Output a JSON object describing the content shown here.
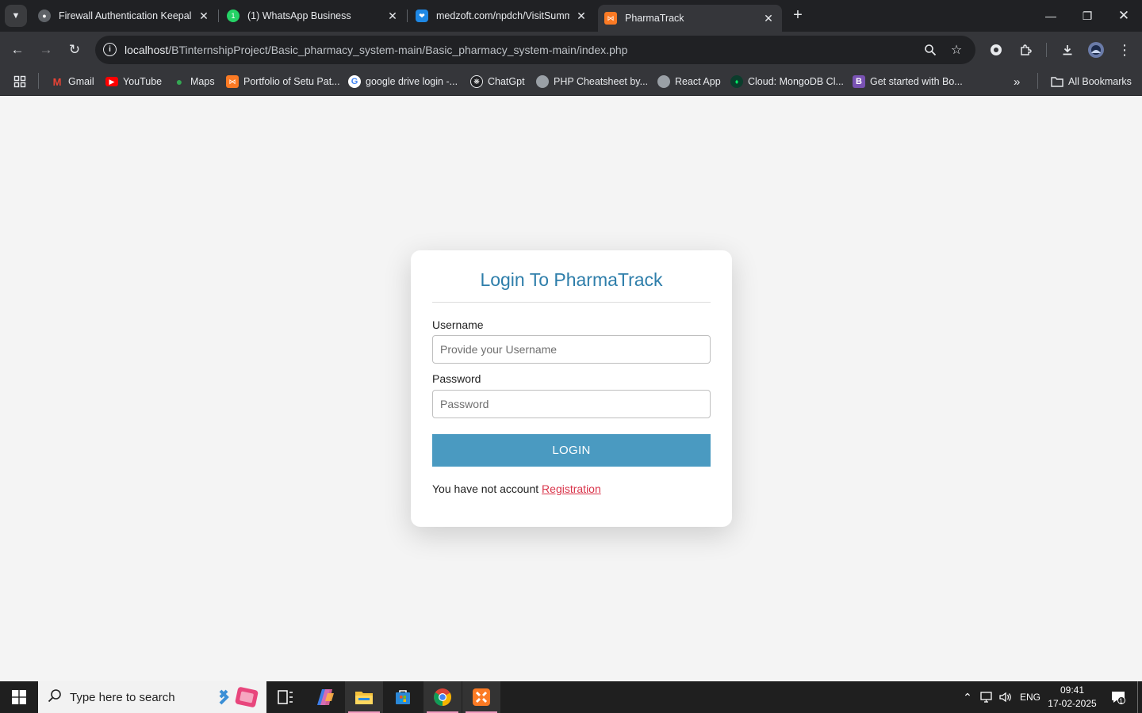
{
  "browser": {
    "tabs": [
      {
        "title": "Firewall Authentication Keepalive",
        "favicon": "globe-icon",
        "active": false
      },
      {
        "title": "(1) WhatsApp Business",
        "favicon": "whatsapp-icon",
        "active": false
      },
      {
        "title": "medzoft.com/npdch/VisitSummary",
        "favicon": "medzoft-icon",
        "active": false
      },
      {
        "title": "PharmaTrack",
        "favicon": "xampp-icon",
        "active": true
      }
    ],
    "address": {
      "host": "localhost",
      "path": "/BTinternshipProject/Basic_pharmacy_system-main/Basic_pharmacy_system-main/index.php"
    },
    "bookmarks": [
      {
        "label": "Gmail",
        "icon": "gmail-icon"
      },
      {
        "label": "YouTube",
        "icon": "youtube-icon"
      },
      {
        "label": "Maps",
        "icon": "maps-icon"
      },
      {
        "label": "Portfolio of Setu Pat...",
        "icon": "xampp-icon"
      },
      {
        "label": "google drive login -...",
        "icon": "google-icon"
      },
      {
        "label": "ChatGpt",
        "icon": "chatgpt-icon"
      },
      {
        "label": "PHP Cheatsheet by...",
        "icon": "globe-icon"
      },
      {
        "label": "React App",
        "icon": "globe-icon"
      },
      {
        "label": "Cloud: MongoDB Cl...",
        "icon": "mongodb-icon"
      },
      {
        "label": "Get started with Bo...",
        "icon": "bootstrap-icon"
      }
    ],
    "all_bookmarks": "All Bookmarks"
  },
  "login": {
    "title": "Login To PharmaTrack",
    "username_label": "Username",
    "username_placeholder": "Provide your Username",
    "password_label": "Password",
    "password_placeholder": "Password",
    "button": "LOGIN",
    "register_text": "You have not account",
    "register_link": "Registration"
  },
  "taskbar": {
    "search_placeholder": "Type here to search",
    "language": "ENG",
    "time": "09:41",
    "date": "17-02-2025",
    "notification_count": "1"
  },
  "colors": {
    "title": "#2e7eaa",
    "button": "#4a9ac1",
    "link": "#d9344a",
    "page_bg": "#f4f4f4"
  }
}
